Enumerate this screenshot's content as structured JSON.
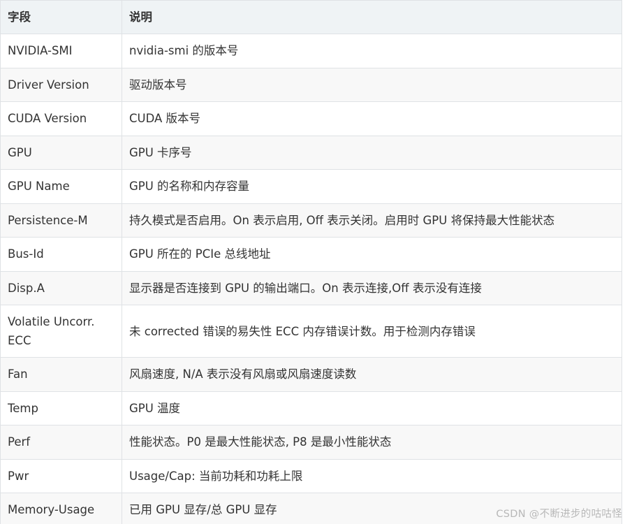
{
  "table": {
    "headers": [
      "字段",
      "说明"
    ],
    "rows": [
      [
        "NVIDIA-SMI",
        "nvidia-smi 的版本号"
      ],
      [
        "Driver Version",
        "驱动版本号"
      ],
      [
        "CUDA Version",
        "CUDA 版本号"
      ],
      [
        "GPU",
        "GPU 卡序号"
      ],
      [
        "GPU Name",
        "GPU 的名称和内存容量"
      ],
      [
        "Persistence-M",
        "持久模式是否启用。On 表示启用, Off 表示关闭。启用时 GPU 将保持最大性能状态"
      ],
      [
        "Bus-Id",
        "GPU 所在的 PCIe 总线地址"
      ],
      [
        "Disp.A",
        "显示器是否连接到 GPU 的输出端口。On 表示连接,Off 表示没有连接"
      ],
      [
        "Volatile Uncorr. ECC",
        "未 corrected 错误的易失性 ECC 内存错误计数。用于检测内存错误"
      ],
      [
        "Fan",
        "风扇速度, N/A 表示没有风扇或风扇速度读数"
      ],
      [
        "Temp",
        "GPU 温度"
      ],
      [
        "Perf",
        "性能状态。P0 是最大性能状态, P8 是最小性能状态"
      ],
      [
        "Pwr",
        "Usage/Cap: 当前功耗和功耗上限"
      ],
      [
        "Memory-Usage",
        "已用 GPU 显存/总 GPU 显存"
      ]
    ]
  },
  "watermark": "CSDN @不断进步的咕咕怪"
}
